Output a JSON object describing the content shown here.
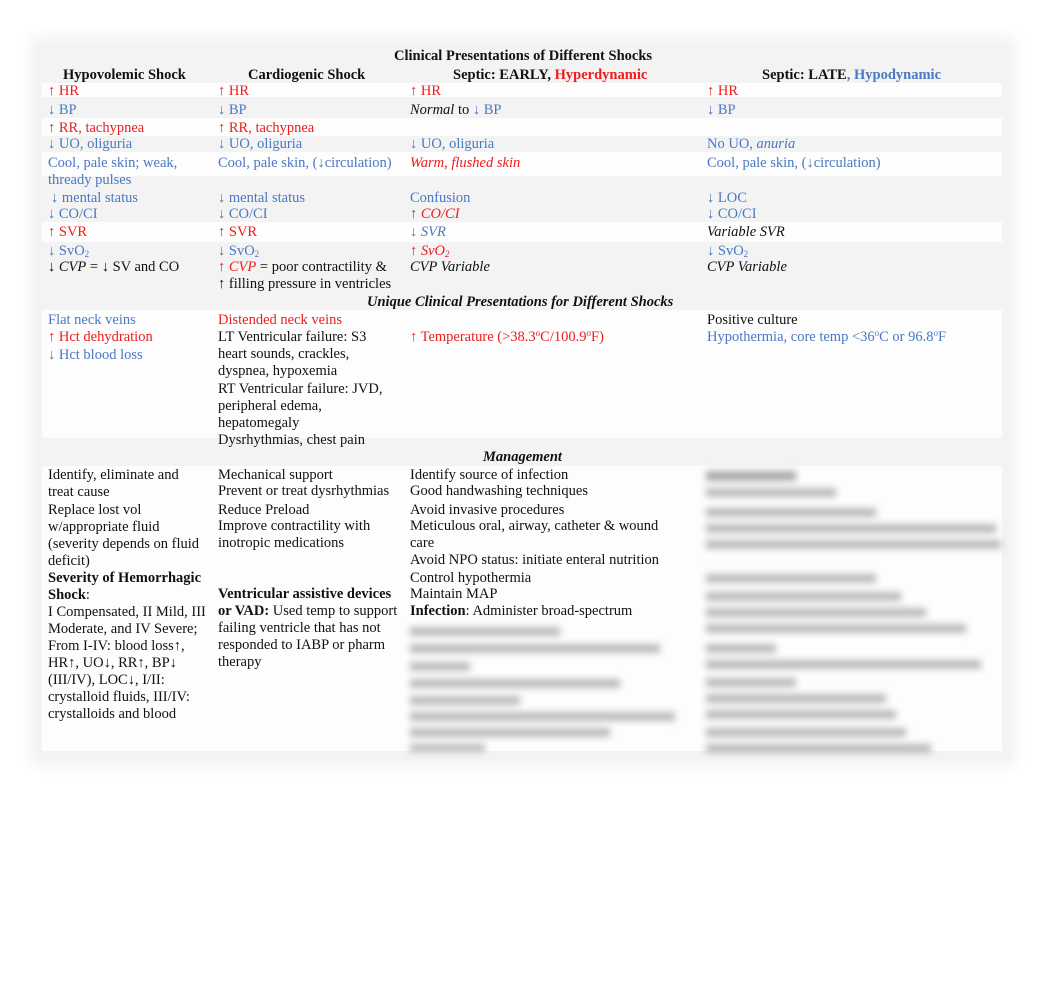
{
  "title": "Clinical Presentations of Different Shocks",
  "columns": [
    {
      "label": "Hypovolemic Shock"
    },
    {
      "label": "Cardiogenic Shock"
    },
    {
      "label_prefix": "Septic: EARLY, ",
      "label_accent": "Hyperdynamic",
      "accent_color": "#ee1c1c"
    },
    {
      "label_prefix": "Septic: LATE",
      "label_accent": ", Hypodynamic",
      "accent_color": "#4a78c2"
    }
  ],
  "colors": {
    "increase": "#ee1c1c",
    "decrease": "#4a78c2",
    "neutral": "#111111"
  },
  "presentations": {
    "hypovolemic": {
      "hr": "↑ HR",
      "bp": "↓ BP",
      "rr": "↑ RR, tachypnea",
      "uo": "↓ UO, oliguria",
      "skin": "Cool, pale skin; weak, thready pulses",
      "mental": "↓ mental status",
      "coci": "↓ CO/CI",
      "svr": "↑ SVR",
      "svo2": "↓ SvO",
      "cvp_arrow": "↓ ",
      "cvp": "CVP",
      "cvp_rest": " = ↓ SV and CO"
    },
    "cardiogenic": {
      "hr": "↑ HR",
      "bp": "↓ BP",
      "rr": "↑ RR, tachypnea",
      "uo": "↓ UO, oliguria",
      "skin": "Cool, pale skin, (↓circulation)",
      "mental": "↓ mental status",
      "coci": "↓ CO/CI",
      "svr": "↑ SVR",
      "svo2": "↓ SvO",
      "cvp_arrow": "↑ ",
      "cvp": "CVP",
      "cvp_rest": " = poor contractility &",
      "cvp_rest2": "↑ filling pressure in ventricles"
    },
    "septic_early": {
      "hr": "↑ HR",
      "bp_normal": "Normal",
      "bp_to": " to ",
      "bp": "↓ BP",
      "uo": "↓ UO, oliguria",
      "skin": "Warm, flushed skin",
      "mental": "Confusion",
      "coci_arrow": "↑ ",
      "coci": "CO/CI",
      "svr_arrow": "↓ ",
      "svr": "SVR",
      "svo2_arrow": "↑ ",
      "svo2": "SvO",
      "cvp": "CVP Variable"
    },
    "septic_late": {
      "hr": "↑ HR",
      "bp": "↓ BP",
      "uo": "No UO, ",
      "uo_italic": "anuria",
      "skin": "Cool, pale skin, (↓circulation)",
      "mental": "↓ LOC",
      "coci": "↓ CO/CI",
      "svr": "Variable SVR",
      "svo2": "↓ SvO",
      "cvp": "CVP Variable"
    },
    "o2_subscript": "2"
  },
  "unique_section": {
    "title": "Unique Clinical Presentations for Different Shocks",
    "hypovolemic": [
      "Flat neck veins",
      "↑ Hct dehydration",
      "↓ Hct blood loss"
    ],
    "cardiogenic": {
      "veins": "Distended neck veins",
      "lt": "LT Ventricular failure: S3 heart sounds, crackles, dyspnea, hypoxemia",
      "rt": "RT Ventricular failure: JVD, peripheral edema, hepatomegaly",
      "dys": "Dysrhythmias, chest pain"
    },
    "septic_early": {
      "temp_prefix": "↑ Temperature (>38.3",
      "temp_mid": "C/100.9",
      "temp_suffix": "F)"
    },
    "septic_late": {
      "culture": "Positive culture",
      "hypo_prefix": "Hypothermia, core temp <36",
      "hypo_mid": "C or 96.8",
      "hypo_suffix": "F"
    },
    "degree": "o"
  },
  "management": {
    "title": "Management",
    "hypovolemic": {
      "p1": "Identify, eliminate and treat cause",
      "p2": "Replace lost vol w/appropriate fluid (severity depends on fluid deficit)",
      "sev_bold": "Severity of Hemorrhagic Shock",
      "sev_colon": ":",
      "sev_text": "I Compensated, II Mild, III Moderate, and IV Severe; From I-IV: blood loss↑, HR↑, UO↓, RR↑, BP↓ (III/IV), LOC↓, I/II: crystalloid fluids, III/IV: crystalloids and blood"
    },
    "cardiogenic": {
      "p1": "Mechanical support",
      "p2": "Prevent or treat dysrhythmias",
      "p3": "Reduce Preload",
      "p4": "Improve contractility with inotropic medications",
      "vad_bold": "Ventricular assistive devices or VAD:",
      "vad_text": " Used temp to support failing ventricle that has not responded to IABP or pharm therapy"
    },
    "septic_early": {
      "items": [
        "Identify source of infection",
        "Good handwashing techniques",
        "Avoid invasive procedures",
        "Meticulous oral, airway, catheter & wound care",
        "Avoid NPO status: initiate enteral nutrition",
        "Control hypothermia",
        "Maintain MAP"
      ],
      "infection_bold": "Infection",
      "infection_text": ": Administer broad-spectrum"
    }
  }
}
